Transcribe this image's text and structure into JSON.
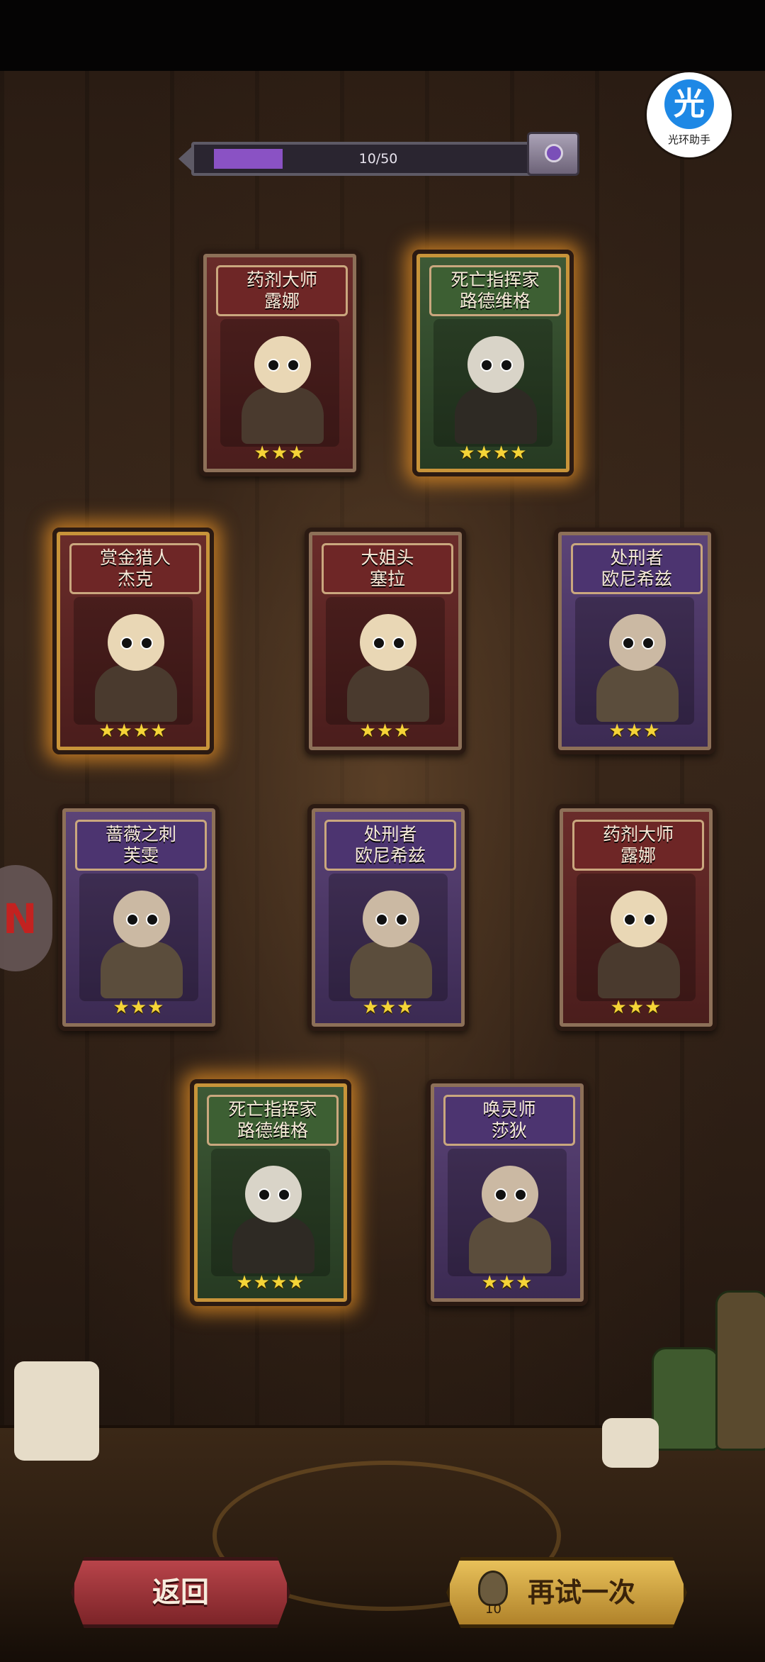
{
  "progress": {
    "text": "10/50",
    "fraction": 0.2
  },
  "assistant": {
    "icon_char": "光",
    "label": "光环助手"
  },
  "cards": [
    {
      "title1": "药剂大师",
      "title2": "露娜",
      "stars": "★★★",
      "theme": "red",
      "glow": false
    },
    {
      "title1": "死亡指挥家",
      "title2": "路德维格",
      "stars": "★★★★",
      "theme": "green",
      "glow": true
    },
    {
      "title1": "赏金猎人",
      "title2": "杰克",
      "stars": "★★★★",
      "theme": "red",
      "glow": true
    },
    {
      "title1": "大姐头",
      "title2": "塞拉",
      "stars": "★★★",
      "theme": "red",
      "glow": false
    },
    {
      "title1": "处刑者",
      "title2": "欧尼希兹",
      "stars": "★★★",
      "theme": "purple",
      "glow": false
    },
    {
      "title1": "蔷薇之刺",
      "title2": "芙雯",
      "stars": "★★★",
      "theme": "purple",
      "glow": false
    },
    {
      "title1": "处刑者",
      "title2": "欧尼希兹",
      "stars": "★★★",
      "theme": "purple",
      "glow": false
    },
    {
      "title1": "药剂大师",
      "title2": "露娜",
      "stars": "★★★",
      "theme": "red",
      "glow": false
    },
    {
      "title1": "死亡指挥家",
      "title2": "路德维格",
      "stars": "★★★★",
      "theme": "green",
      "glow": true
    },
    {
      "title1": "唤灵师",
      "title2": "莎狄",
      "stars": "★★★",
      "theme": "purple",
      "glow": false
    }
  ],
  "buttons": {
    "back_label": "返回",
    "retry_label": "再试一次",
    "retry_cost": "10"
  },
  "colors": {
    "glow": "#ffa028",
    "star": "#f5d437",
    "progress": "#8a52c4"
  },
  "icons": {
    "side_tab": "red-logo-icon",
    "retry": "summon-bell-icon",
    "chest": "chest-icon"
  }
}
